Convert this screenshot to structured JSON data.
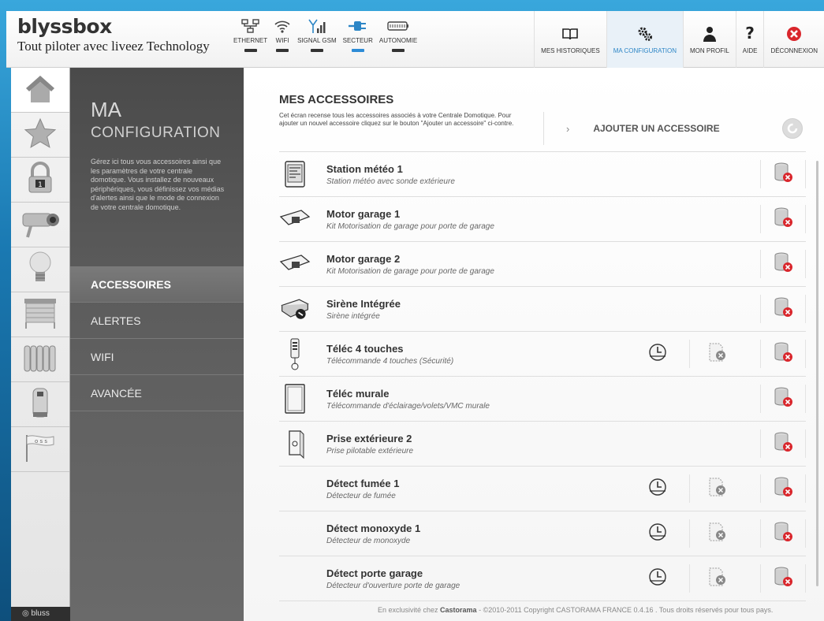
{
  "app": {
    "brand": "blyssbox",
    "tagline": "Tout piloter avec liveez Technology"
  },
  "status": [
    {
      "label": "ETHERNET",
      "icon": "ethernet-icon",
      "active": false
    },
    {
      "label": "WIFI",
      "icon": "wifi-icon",
      "active": false
    },
    {
      "label": "SIGNAL GSM",
      "icon": "signal-gsm-icon",
      "active": false
    },
    {
      "label": "SECTEUR",
      "icon": "plug-icon",
      "active": true
    },
    {
      "label": "AUTONOMIE",
      "icon": "battery-icon",
      "active": false
    }
  ],
  "nav": [
    {
      "label": "MES HISTORIQUES",
      "icon": "book-icon"
    },
    {
      "label": "MA CONFIGURATION",
      "icon": "gears-icon",
      "active": true
    },
    {
      "label": "MON PROFIL",
      "icon": "user-icon"
    },
    {
      "label": "AIDE",
      "icon": "help-icon"
    },
    {
      "label": "DÉCONNEXION",
      "icon": "logout-icon"
    }
  ],
  "sidebar_icons": [
    "home-icon",
    "star-icon",
    "padlock-icon",
    "camera-icon",
    "bulb-icon",
    "shutter-icon",
    "radiator-icon",
    "cylinder-icon",
    "flag-icon"
  ],
  "panel": {
    "title1": "MA",
    "title2": "CONFIGURATION",
    "description": "Gérez ici tous vous accessoires ainsi que les paramètres de votre centrale domotique. Vous installez de nouveaux périphériques, vous définissez vos médias d'alertes ainsi que le mode de connexion de votre centrale domotique.",
    "menu": [
      {
        "label": "ACCESSOIRES",
        "active": true
      },
      {
        "label": "ALERTES"
      },
      {
        "label": "WIFI"
      },
      {
        "label": "AVANCÉE"
      }
    ],
    "footer_logo": "bluss"
  },
  "main": {
    "title": "MES ACCESSOIRES",
    "description": "Cet écran recense tous les accessoires associés à votre Centrale Domotique. Pour ajouter un nouvel accessoire cliquez sur le bouton \"Ajouter un  accessoire\" ci-contre.",
    "add_chevron": "›",
    "add_label": "AJOUTER UN ACCESSOIRE",
    "accessories": [
      {
        "name": "Station météo 1",
        "sub": "Station météo avec sonde extérieure",
        "thumb": "weather-station-icon",
        "extra": false
      },
      {
        "name": "Motor garage 1",
        "sub": "Kit Motorisation de garage pour porte de garage",
        "thumb": "garage-motor-icon",
        "extra": false
      },
      {
        "name": "Motor garage 2",
        "sub": "Kit Motorisation de garage pour porte de garage",
        "thumb": "garage-motor-icon",
        "extra": false
      },
      {
        "name": "Sirène Intégrée",
        "sub": "Sirène intégrée",
        "thumb": "siren-icon",
        "extra": false
      },
      {
        "name": "Téléc 4 touches",
        "sub": "Télécommande 4 touches (Sécurité)",
        "thumb": "remote-icon",
        "extra": true
      },
      {
        "name": "Téléc murale",
        "sub": "Télécommande d'éclairage/volets/VMC murale",
        "thumb": "wall-remote-icon",
        "extra": false
      },
      {
        "name": "Prise extérieure 2",
        "sub": "Prise pilotable extérieure",
        "thumb": "outdoor-plug-icon",
        "extra": false
      },
      {
        "name": "Détect fumée 1",
        "sub": "Détecteur de fumée",
        "thumb": "",
        "extra": true
      },
      {
        "name": "Détect monoxyde 1",
        "sub": "Détecteur de monoxyde",
        "thumb": "",
        "extra": true
      },
      {
        "name": "Détect porte garage",
        "sub": "Détecteur d'ouverture porte de garage",
        "thumb": "",
        "extra": true
      }
    ],
    "footer_prefix": "En exclusivité chez ",
    "footer_brand": "Castorama",
    "footer_suffix": " - ©2010-2011 Copyright CASTORAMA FRANCE 0.4.16 . Tous droits réservés pour tous pays."
  },
  "colors": {
    "accent": "#2d86c6",
    "delete_red": "#d9262c"
  }
}
